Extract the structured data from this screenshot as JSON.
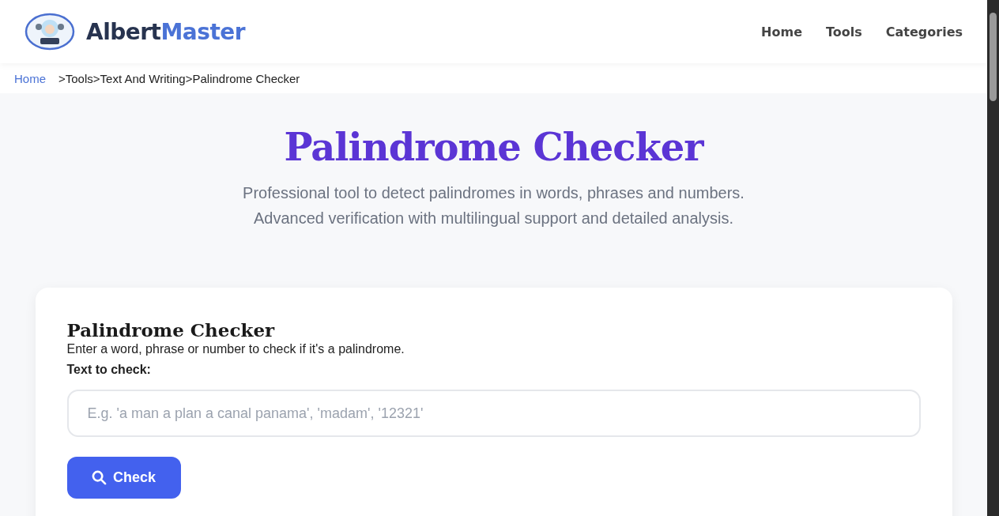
{
  "header": {
    "logo": {
      "primary": "Albert",
      "accent": "Master"
    },
    "nav": [
      {
        "label": "Home"
      },
      {
        "label": "Tools"
      },
      {
        "label": "Categories"
      }
    ]
  },
  "breadcrumb": {
    "separator": ">",
    "items": [
      {
        "label": "Home",
        "kind": "link"
      },
      {
        "label": "Tools",
        "kind": "text"
      },
      {
        "label": "Text And Writing",
        "kind": "text"
      },
      {
        "label": "Palindrome Checker",
        "kind": "text"
      }
    ]
  },
  "hero": {
    "title": "Palindrome Checker",
    "subtitle_lines": [
      "Professional tool to detect palindromes in words, phrases and numbers.",
      "Advanced verification with multilingual support and detailed analysis."
    ]
  },
  "card": {
    "title": "Palindrome Checker",
    "description": "Enter a word, phrase or number to check if it's a palindrome.",
    "field_label": "Text to check:",
    "placeholder": "E.g. 'a man a plan a canal panama', 'madam', '12321'",
    "button": "Check"
  }
}
